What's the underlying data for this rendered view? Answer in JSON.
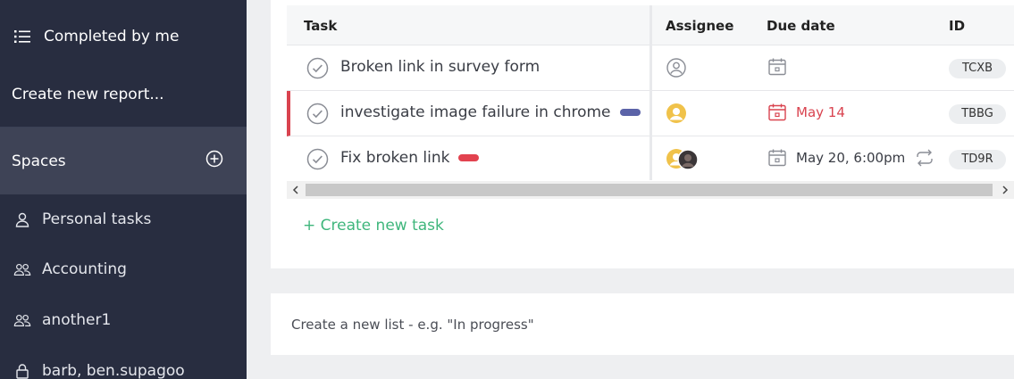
{
  "sidebar": {
    "completed_by_me": "Completed by me",
    "create_report": "Create new report...",
    "spaces_label": "Spaces",
    "items": [
      {
        "label": "Personal tasks",
        "icon": "person-icon"
      },
      {
        "label": "Accounting",
        "icon": "people-icon"
      },
      {
        "label": "another1",
        "icon": "people-icon"
      },
      {
        "label": "barb, ben.supagoo",
        "icon": "lock-icon"
      }
    ]
  },
  "table": {
    "headers": {
      "task": "Task",
      "assignee": "Assignee",
      "due": "Due date",
      "id": "ID"
    },
    "rows": [
      {
        "name": "Broken link in survey form",
        "due": "",
        "id": "TCXB",
        "pill_color": ""
      },
      {
        "name": "investigate image failure in chrome",
        "due": "May 14",
        "id": "TBBG",
        "pill_color": "#5b63a8",
        "overdue": true
      },
      {
        "name": "Fix broken link",
        "due": "May 20, 6:00pm",
        "id": "TD9R",
        "pill_color": "#e2424f",
        "repeat": true
      }
    ]
  },
  "create_task": "+ Create new task",
  "new_list_placeholder": "Create a new list - e.g. \"In progress\"",
  "colors": {
    "sidebar": "#282d40",
    "accent_green": "#3fb67c",
    "overdue_red": "#d9434f"
  }
}
